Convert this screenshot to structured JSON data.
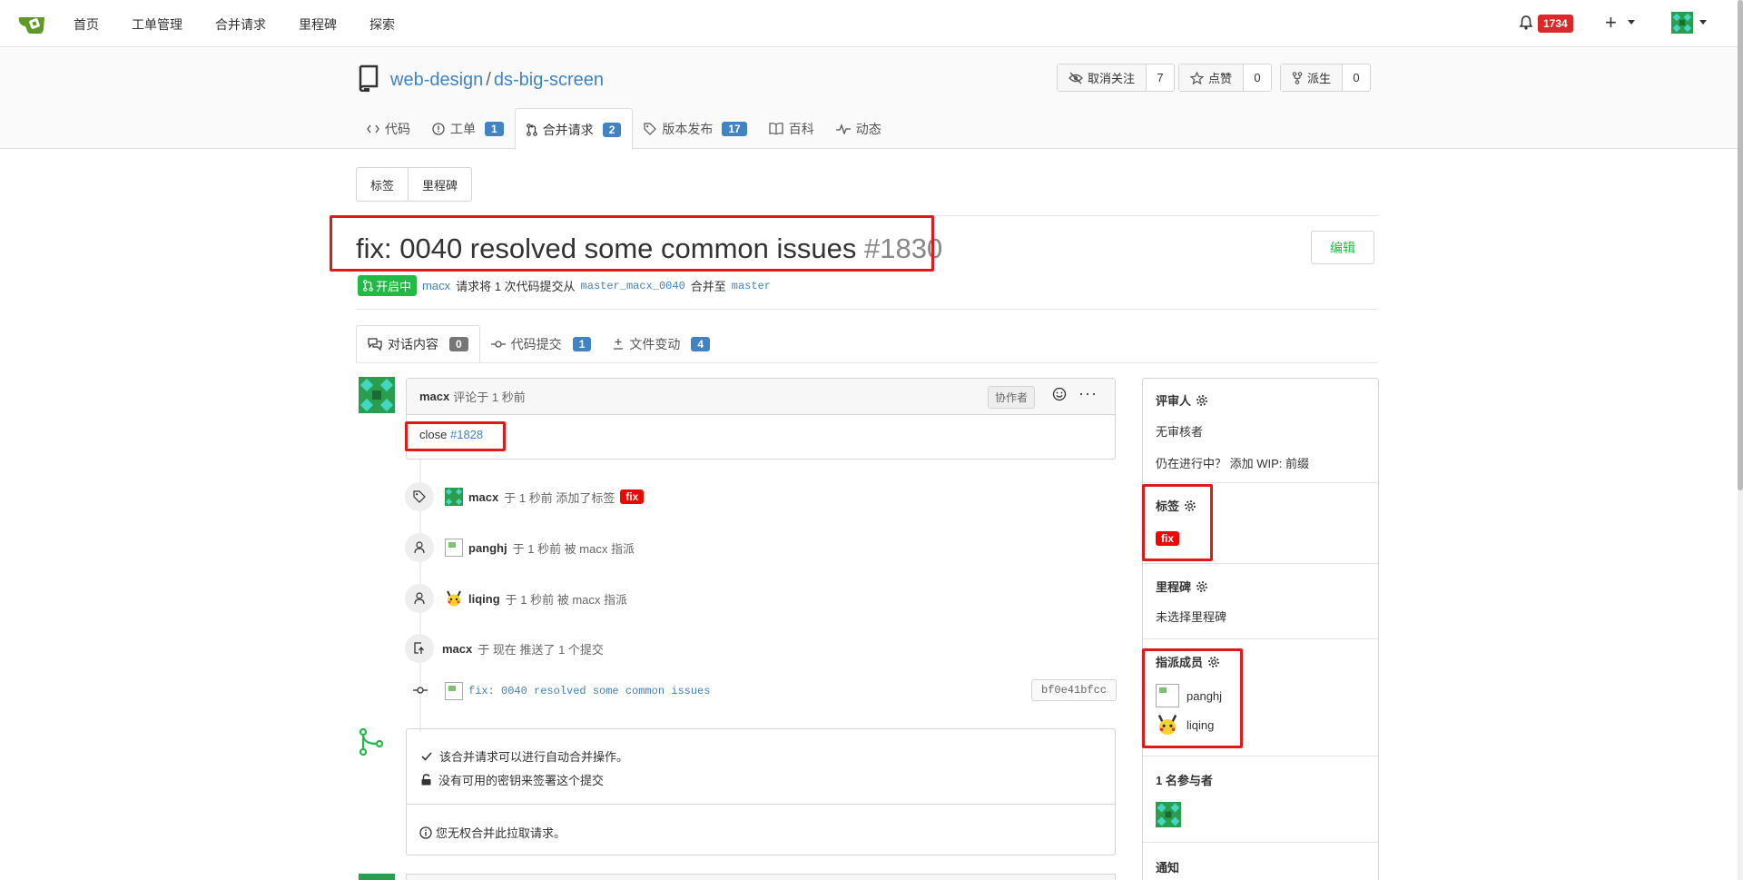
{
  "nav": {
    "items": [
      "首页",
      "工单管理",
      "合并请求",
      "里程碑",
      "探索"
    ],
    "notification_count": "1734",
    "plus": "+"
  },
  "repo": {
    "owner": "web-design",
    "separator": "/",
    "name": "ds-big-screen",
    "watch_label": "取消关注",
    "watch_count": "7",
    "star_label": "点赞",
    "star_count": "0",
    "fork_label": "派生",
    "fork_count": "0",
    "tabs": [
      {
        "label": "代码",
        "icon": "code-icon"
      },
      {
        "label": "工单",
        "icon": "issue-icon",
        "badge": "1"
      },
      {
        "label": "合并请求",
        "icon": "pull-request-icon",
        "badge": "2"
      },
      {
        "label": "版本发布",
        "icon": "tag-icon",
        "badge": "17"
      },
      {
        "label": "百科",
        "icon": "book-icon"
      },
      {
        "label": "动态",
        "icon": "pulse-icon"
      }
    ]
  },
  "labels_milestones": {
    "labels": "标签",
    "milestones": "里程碑"
  },
  "pr": {
    "title": "fix: 0040 resolved some common issues",
    "number": "#1830",
    "edit": "编辑",
    "status": "开启中",
    "author": "macx",
    "request_text": "请求将 1 次代码提交从",
    "head_branch": "master_macx_0040",
    "merge_text": "合并至",
    "base_branch": "master"
  },
  "pr_tabs": [
    {
      "label": "对话内容",
      "badge": "0"
    },
    {
      "label": "代码提交",
      "badge": "1"
    },
    {
      "label": "文件变动",
      "badge": "4"
    }
  ],
  "comment": {
    "author": "macx",
    "meta": "评论于 1 秒前",
    "role": "协作者",
    "body_prefix": "close",
    "body_ref": "#1828"
  },
  "timeline": [
    {
      "user": "macx",
      "text": "于 1 秒前 添加了标签",
      "label": "fix"
    },
    {
      "user": "panghj",
      "text": "于 1 秒前 被 macx 指派"
    },
    {
      "user": "liqing",
      "text": "于 1 秒前 被 macx 指派"
    },
    {
      "user": "macx",
      "text": "于 现在 推送了 1 个提交"
    }
  ],
  "commit": {
    "message": "fix: 0040 resolved some common issues",
    "sha": "bf0e41bfcc"
  },
  "merge": {
    "auto_merge": "该合并请求可以进行自动合并操作。",
    "no_key": "没有可用的密钥来签署这个提交",
    "no_permission": "您无权合并此拉取请求。"
  },
  "sidebar": {
    "reviewers_title": "评审人",
    "no_reviewers": "无审核者",
    "wip_text": "仍在进行中？ 添加 WIP: 前缀",
    "labels_title": "标签",
    "label": "fix",
    "milestone_title": "里程碑",
    "no_milestone": "未选择里程碑",
    "assignees_title": "指派成员",
    "assignees": [
      "panghj",
      "liqing"
    ],
    "participants_title": "1 名参与者",
    "notifications_title": "通知"
  },
  "colors": {
    "accent": "#4183c4",
    "green": "#21ba45",
    "red_label": "#ee0701",
    "badge_red": "#db2828",
    "highlight": "#e01a1a"
  }
}
